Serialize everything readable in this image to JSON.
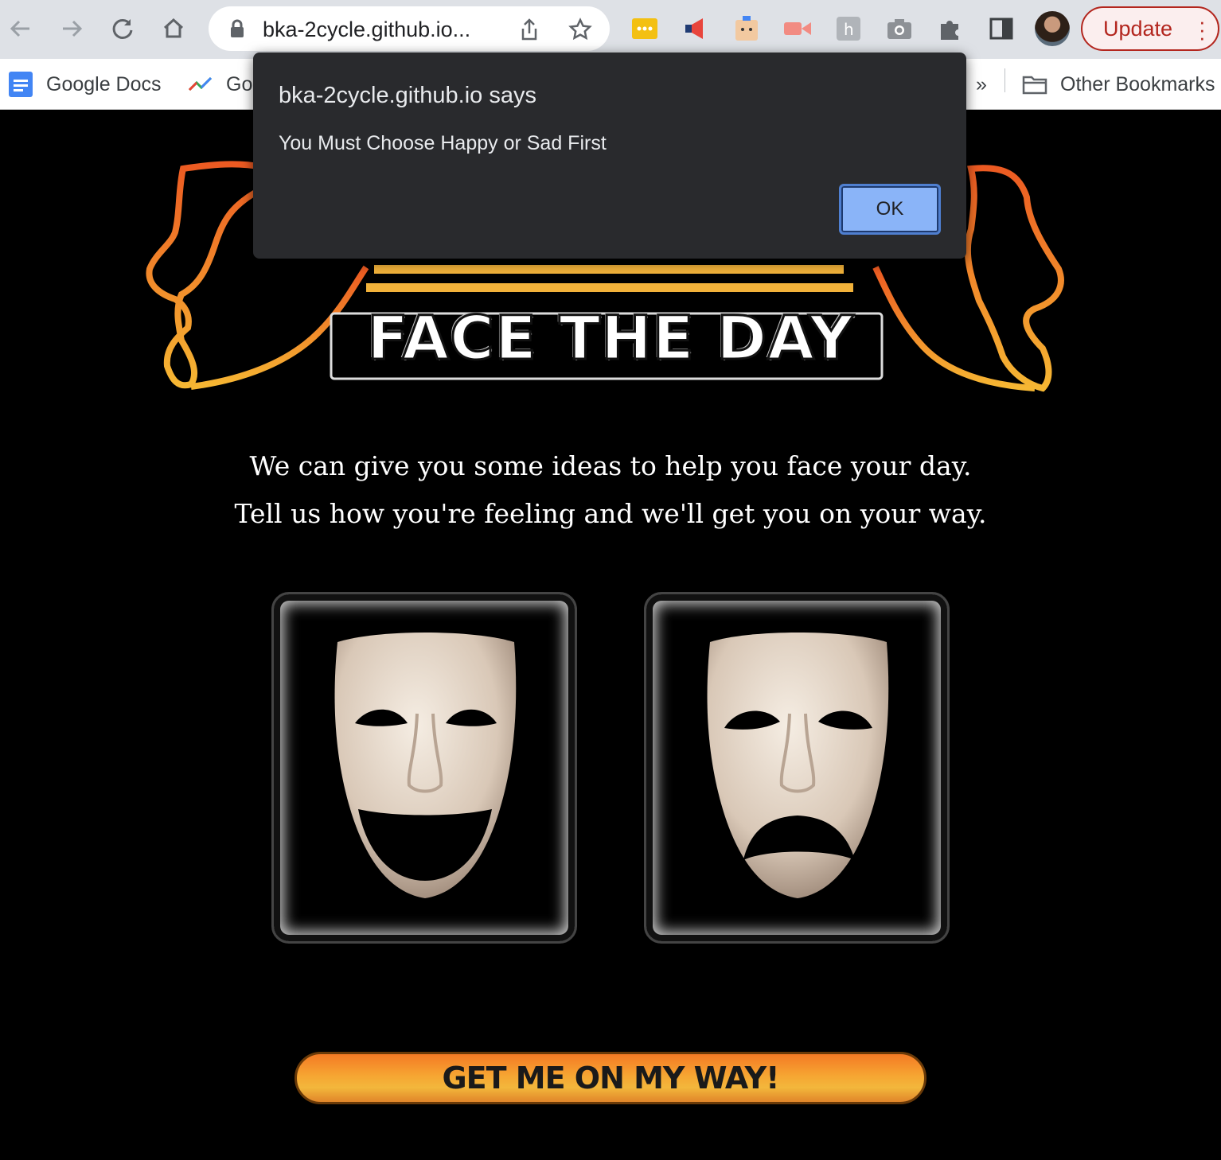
{
  "browser": {
    "url": "bka-2cycle.github.io...",
    "update_label": "Update",
    "bookmarks": [
      {
        "label": "Google Docs"
      },
      {
        "label": "Go"
      }
    ],
    "overflow_label": "»",
    "other_bookmarks_label": "Other Bookmarks",
    "extension_icons": [
      "dots-extension-icon",
      "megaphone-extension-icon",
      "robot-extension-icon",
      "video-extension-icon",
      "h-extension-icon",
      "camera-extension-icon",
      "puzzle-icon",
      "sidepanel-icon"
    ]
  },
  "alert": {
    "title": "bka-2cycle.github.io says",
    "message": "You Must Choose Happy or Sad First",
    "ok_label": "OK"
  },
  "page": {
    "title": "FACE THE DAY",
    "intro_line1": "We can give you some ideas to help you face your day.",
    "intro_line2": "Tell us how you're feeling and we'll get you on your way.",
    "happy_mask_name": "happy-mask",
    "sad_mask_name": "sad-mask",
    "cta_label": "GET ME ON MY WAY!"
  },
  "colors": {
    "accent_orange": "#f47a24",
    "accent_gold": "#f3b73c",
    "dialog_bg": "#292a2d",
    "ok_blue": "#8ab4f8",
    "update_red": "#b3261e"
  }
}
